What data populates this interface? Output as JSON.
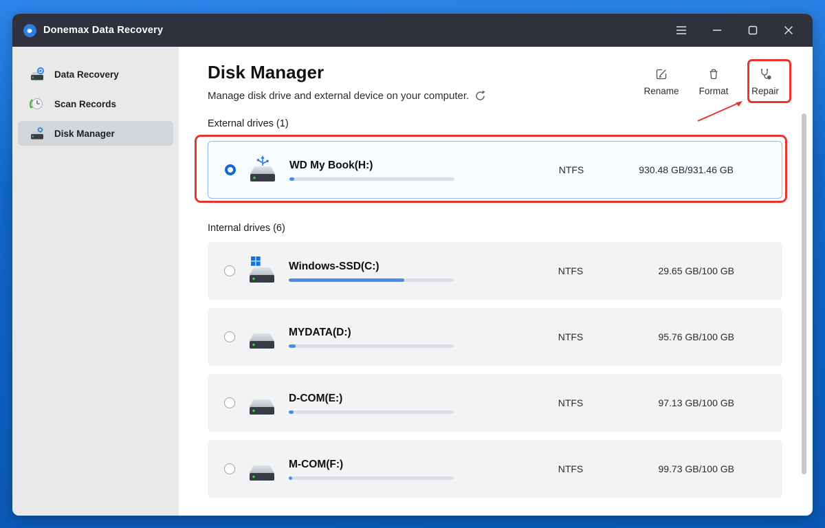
{
  "window": {
    "title": "Donemax Data Recovery"
  },
  "titlebar_controls": [
    {
      "name": "menu"
    },
    {
      "name": "minimize"
    },
    {
      "name": "maximize"
    },
    {
      "name": "close"
    }
  ],
  "sidebar": {
    "items": [
      {
        "label": "Data Recovery",
        "icon": "drive-recovery-icon",
        "active": false
      },
      {
        "label": "Scan Records",
        "icon": "scan-records-icon",
        "active": false
      },
      {
        "label": "Disk Manager",
        "icon": "disk-gear-icon",
        "active": true
      }
    ]
  },
  "header": {
    "title": "Disk Manager",
    "subtitle": "Manage disk drive and external device on your computer.",
    "refresh_icon": "circular-arrow"
  },
  "toolbar": {
    "rename": "Rename",
    "format": "Format",
    "repair": "Repair"
  },
  "sections": {
    "external": "External drives (1)",
    "internal": "Internal drives (6)"
  },
  "drives": {
    "external": [
      {
        "name": "WD My Book(H:)",
        "fs": "NTFS",
        "capacity": "930.48 GB/931.46 GB",
        "used_pct": 3,
        "selected": true,
        "badge": "usb"
      }
    ],
    "internal": [
      {
        "name": "Windows-SSD(C:)",
        "fs": "NTFS",
        "capacity": "29.65 GB/100 GB",
        "used_pct": 70,
        "selected": false,
        "badge": "windows"
      },
      {
        "name": "MYDATA(D:)",
        "fs": "NTFS",
        "capacity": "95.76 GB/100 GB",
        "used_pct": 4,
        "selected": false,
        "badge": null
      },
      {
        "name": "D-COM(E:)",
        "fs": "NTFS",
        "capacity": "97.13 GB/100 GB",
        "used_pct": 3,
        "selected": false,
        "badge": null
      },
      {
        "name": "M-COM(F:)",
        "fs": "NTFS",
        "capacity": "99.73 GB/100 GB",
        "used_pct": 2,
        "selected": false,
        "badge": null
      }
    ]
  },
  "annotations": {
    "highlight_color": "#e8342c",
    "highlighted_action": "Repair",
    "highlighted_drive": "WD My Book(H:)"
  },
  "colors": {
    "accent": "#1268d8",
    "bar_fill": "#4a8be4",
    "titlebar": "#2f323c",
    "selected_row_border": "#92bdf0",
    "sidebar_bg": "#e9e9ea"
  }
}
